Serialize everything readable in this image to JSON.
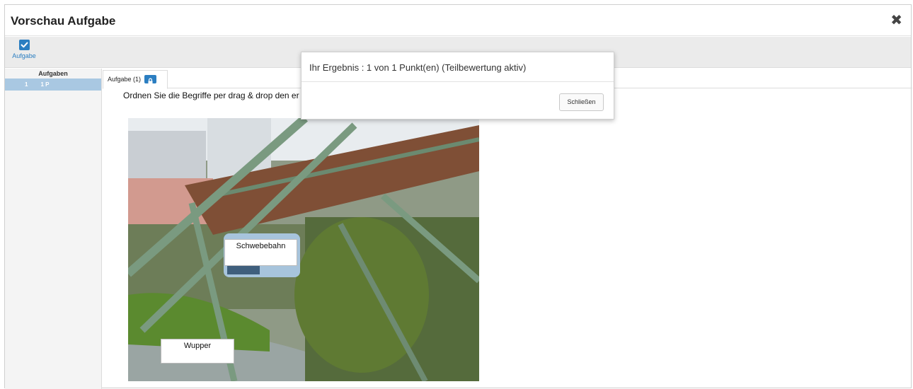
{
  "window": {
    "title": "Vorschau Aufgabe",
    "close_glyph": "✖"
  },
  "toolbar": {
    "check_button": {
      "label": "Aufgabe",
      "icon": "checkbox-checked-icon"
    }
  },
  "sidebar": {
    "heading": "Aufgaben",
    "items": [
      {
        "number": "1",
        "points": "1 P"
      }
    ]
  },
  "tabs": [
    {
      "label": "Aufgabe (1)",
      "icon": "lock-icon"
    }
  ],
  "question": {
    "text": "Ordnen Sie die Begriffe per drag & drop den er"
  },
  "drop_targets": [
    {
      "label": "Schwebebahn"
    },
    {
      "label": "Wupper"
    }
  ],
  "modal": {
    "message": "Ihr Ergebnis : 1 von 1 Punkt(en) (Teilbewertung aktiv)",
    "close_label": "Schließen"
  },
  "colors": {
    "accent": "#2b7ec1",
    "selected_row": "#a9c8e2"
  }
}
